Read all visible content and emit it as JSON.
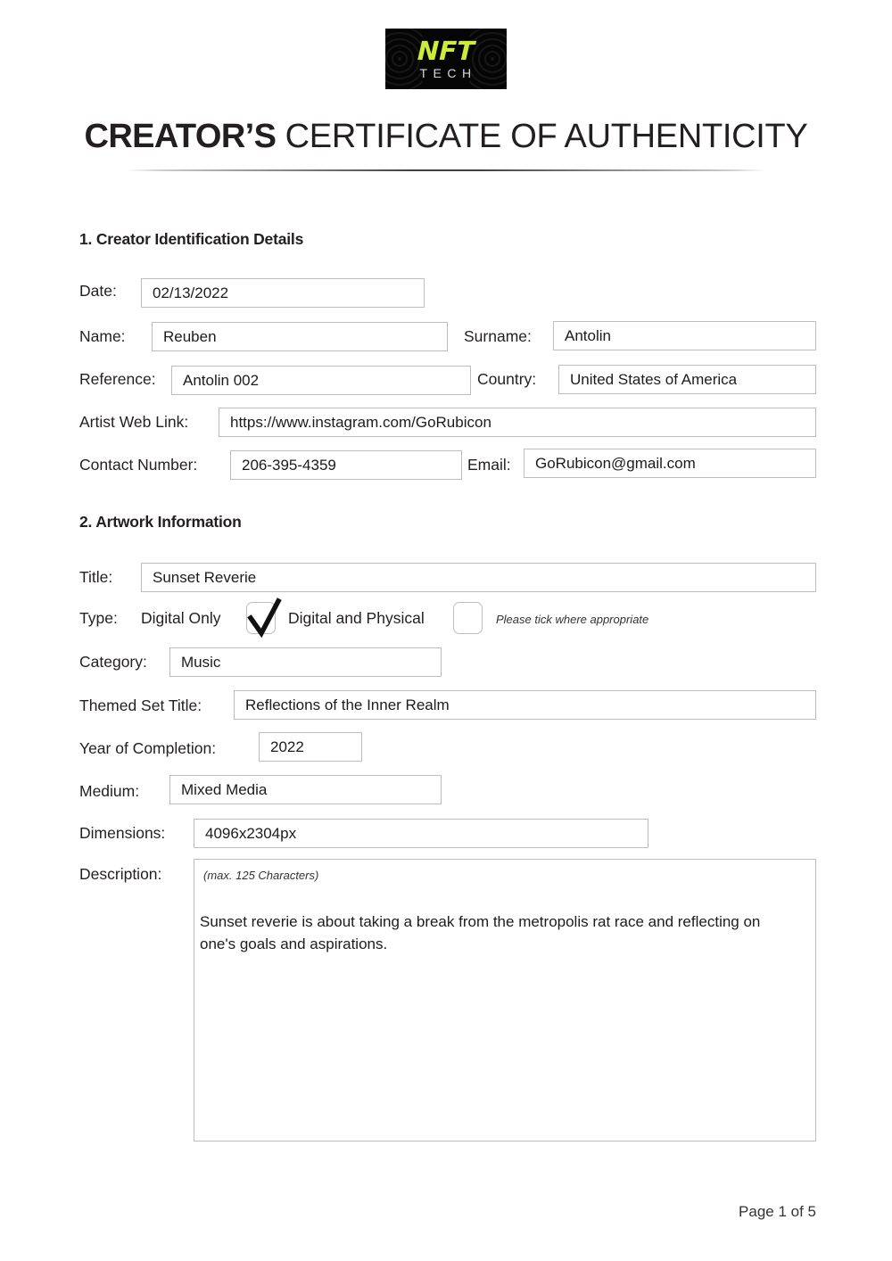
{
  "logo": {
    "primary_text": "NFT",
    "secondary_text": "TECH",
    "primary_color": "#ccec3c",
    "secondary_color": "#d8d8d8",
    "background_color": "#050505"
  },
  "header": {
    "title_strong": "CREATOR’S",
    "title_rest": "CERTIFICATE OF AUTHENTICITY"
  },
  "sections": {
    "one": {
      "heading": "1. Creator Identification Details",
      "fields": {
        "date_label": "Date:",
        "date_value": "02/13/2022",
        "name_label": "Name:",
        "name_value": "Reuben",
        "surname_label": "Surname:",
        "surname_value": "Antolin",
        "reference_label": "Reference:",
        "reference_value": "Antolin 002",
        "country_label": "Country:",
        "country_value": "United States of America",
        "weblink_label": "Artist Web Link:",
        "weblink_value": "https://www.instagram.com/GoRubicon",
        "contact_label": "Contact Number:",
        "contact_value": "206-395-4359",
        "email_label": "Email:",
        "email_value": "GoRubicon@gmail.com"
      }
    },
    "two": {
      "heading": "2. Artwork Information",
      "fields": {
        "title_label": "Title:",
        "title_value": "Sunset Reverie",
        "type_label": "Type:",
        "type_option_digital_only": "Digital Only",
        "type_option_digital_physical": "Digital and Physical",
        "type_note": "Please tick where appropriate",
        "type_selected": "Digital Only",
        "category_label": "Category:",
        "category_value": "Music",
        "themed_set_label": "Themed Set Title:",
        "themed_set_value": "Reflections of the Inner Realm",
        "year_label": "Year of Completion:",
        "year_value": "2022",
        "medium_label": "Medium:",
        "medium_value": "Mixed Media",
        "dimensions_label": "Dimensions:",
        "dimensions_value": "4096x2304px",
        "description_label": "Description:",
        "description_hint": "(max. 125 Characters)",
        "description_value": "Sunset reverie is about taking a break from the metropolis rat race and reflecting on one's goals and aspirations."
      }
    }
  },
  "footer": {
    "page_indicator": "Page 1 of 5"
  }
}
